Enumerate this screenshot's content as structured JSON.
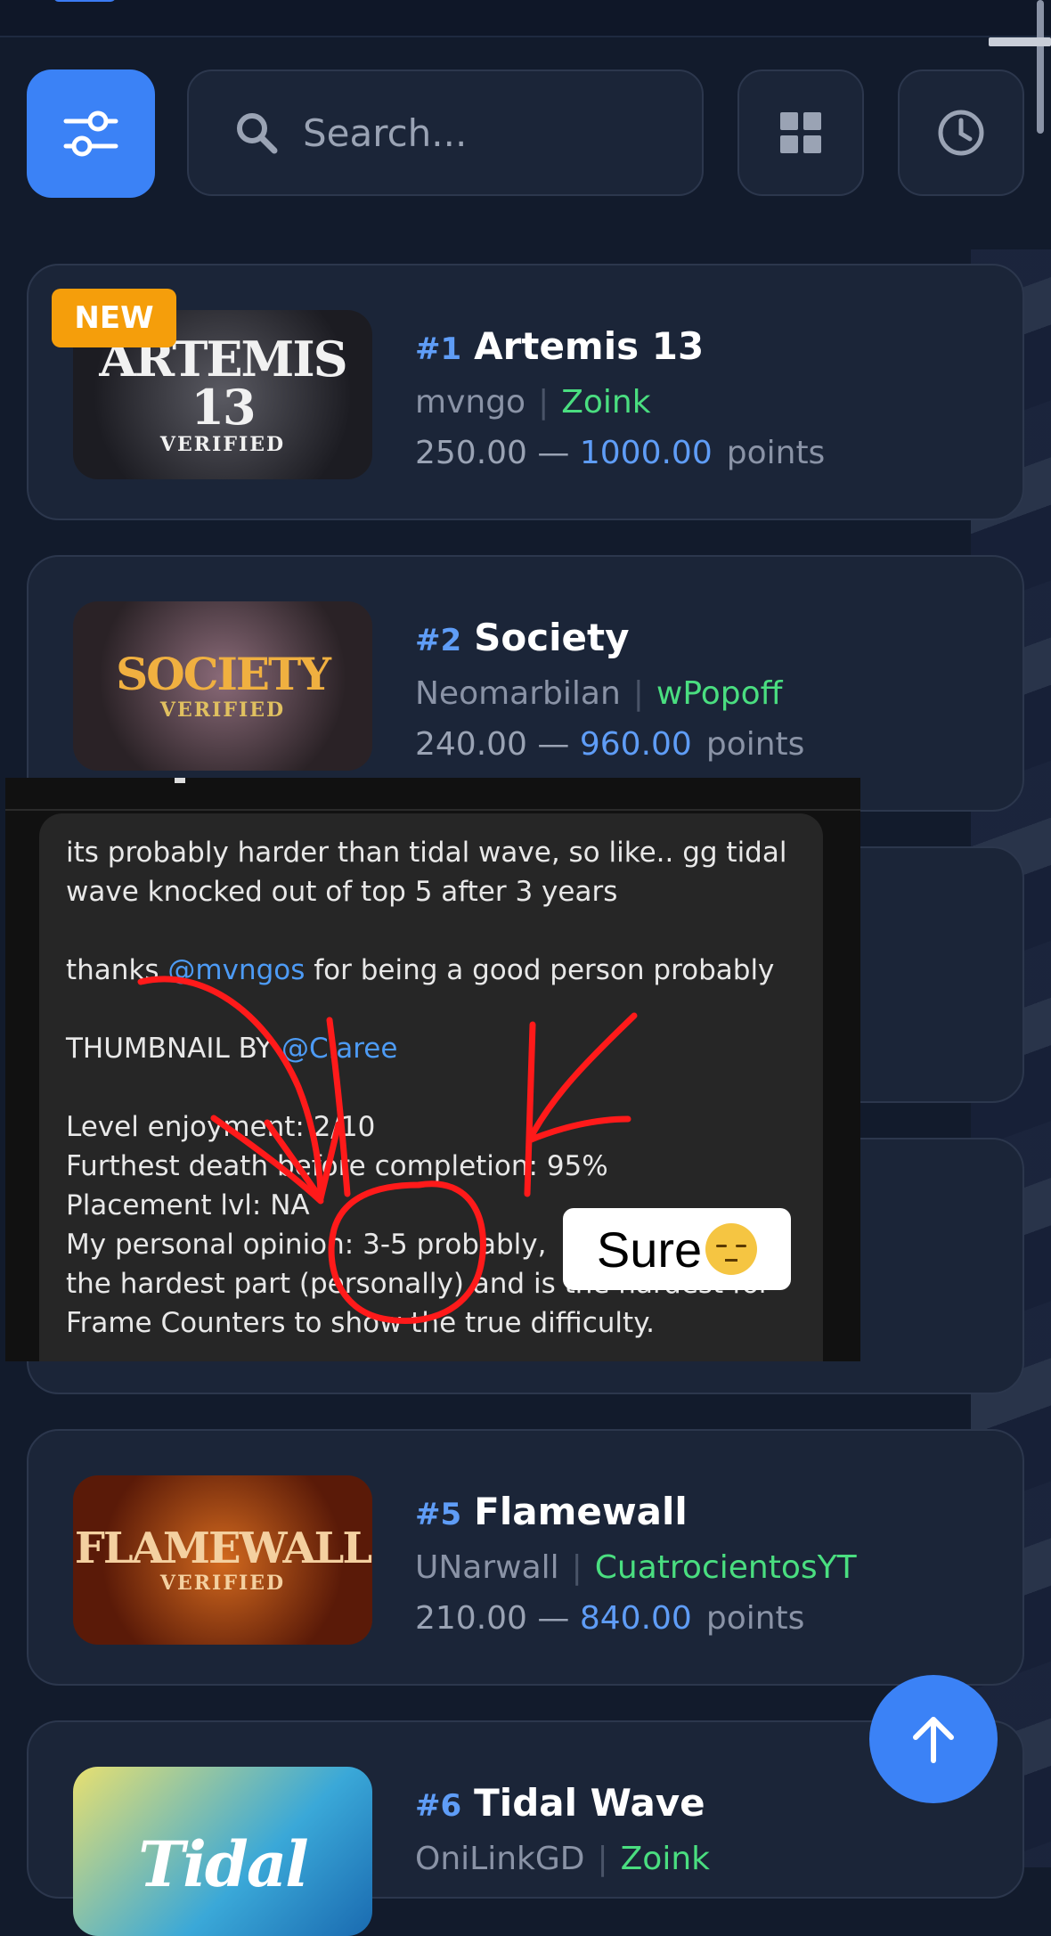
{
  "search": {
    "placeholder": "Search..."
  },
  "toolbar": {
    "filter_icon": "sliders-icon",
    "grid_icon": "grid-icon",
    "history_icon": "clock-icon"
  },
  "levels": [
    {
      "rank": "#1",
      "name": "Artemis 13",
      "creator": "mvngo",
      "verifier": "Zoink",
      "min_points": "250.00",
      "dash": "—",
      "max_points": "1000.00",
      "unit": "points",
      "badge": "NEW",
      "thumb_text": "ARTEMIS 13",
      "thumb_sub": "VERIFIED"
    },
    {
      "rank": "#2",
      "name": "Society",
      "creator": "Neomarbilan",
      "verifier": "wPopoff",
      "min_points": "240.00",
      "dash": "—",
      "max_points": "960.00",
      "unit": "points",
      "thumb_text": "SOCIETY",
      "thumb_sub": "VERIFIED"
    },
    {
      "rank": "#5",
      "name": "Flamewall",
      "creator": "UNarwall",
      "verifier": "CuatrocientosYT",
      "min_points": "210.00",
      "dash": "—",
      "max_points": "840.00",
      "unit": "points",
      "thumb_text": "FLAMEWALL",
      "thumb_sub": "VERIFIED"
    },
    {
      "rank": "#6",
      "name": "Tidal Wave",
      "creator": "OniLinkGD",
      "verifier": "Zoink",
      "thumb_text": "Tidal"
    }
  ],
  "separator": "|",
  "overlay_comment": {
    "line1": "its probably harder than tidal wave, so like.. gg tidal",
    "line2": "wave knocked out of top 5 after 3 years",
    "thanks_pre": "thanks ",
    "thanks_mention": "@mvngos",
    "thanks_post": " for being a good person probably",
    "thumb_pre": "THUMBNAIL BY ",
    "thumb_mention": "@Claree",
    "enjoyment": "Level enjoyment: 2/10",
    "death": "Furthest death before completion: 95%",
    "placement": "Placement lvl: NA",
    "opinion": "My personal opinion: 3-5 probably,",
    "hardest": "the hardest part (personally) and is the hardest for",
    "frame": "Frame Counters to show the true difficulty."
  },
  "sticker": {
    "text": "Sure"
  },
  "fab": {
    "icon": "arrow-up-icon"
  },
  "colors": {
    "accent": "#3b82f6",
    "verifier": "#4ade80",
    "badge": "#f59e0b",
    "annotation": "#ff1a1a"
  }
}
